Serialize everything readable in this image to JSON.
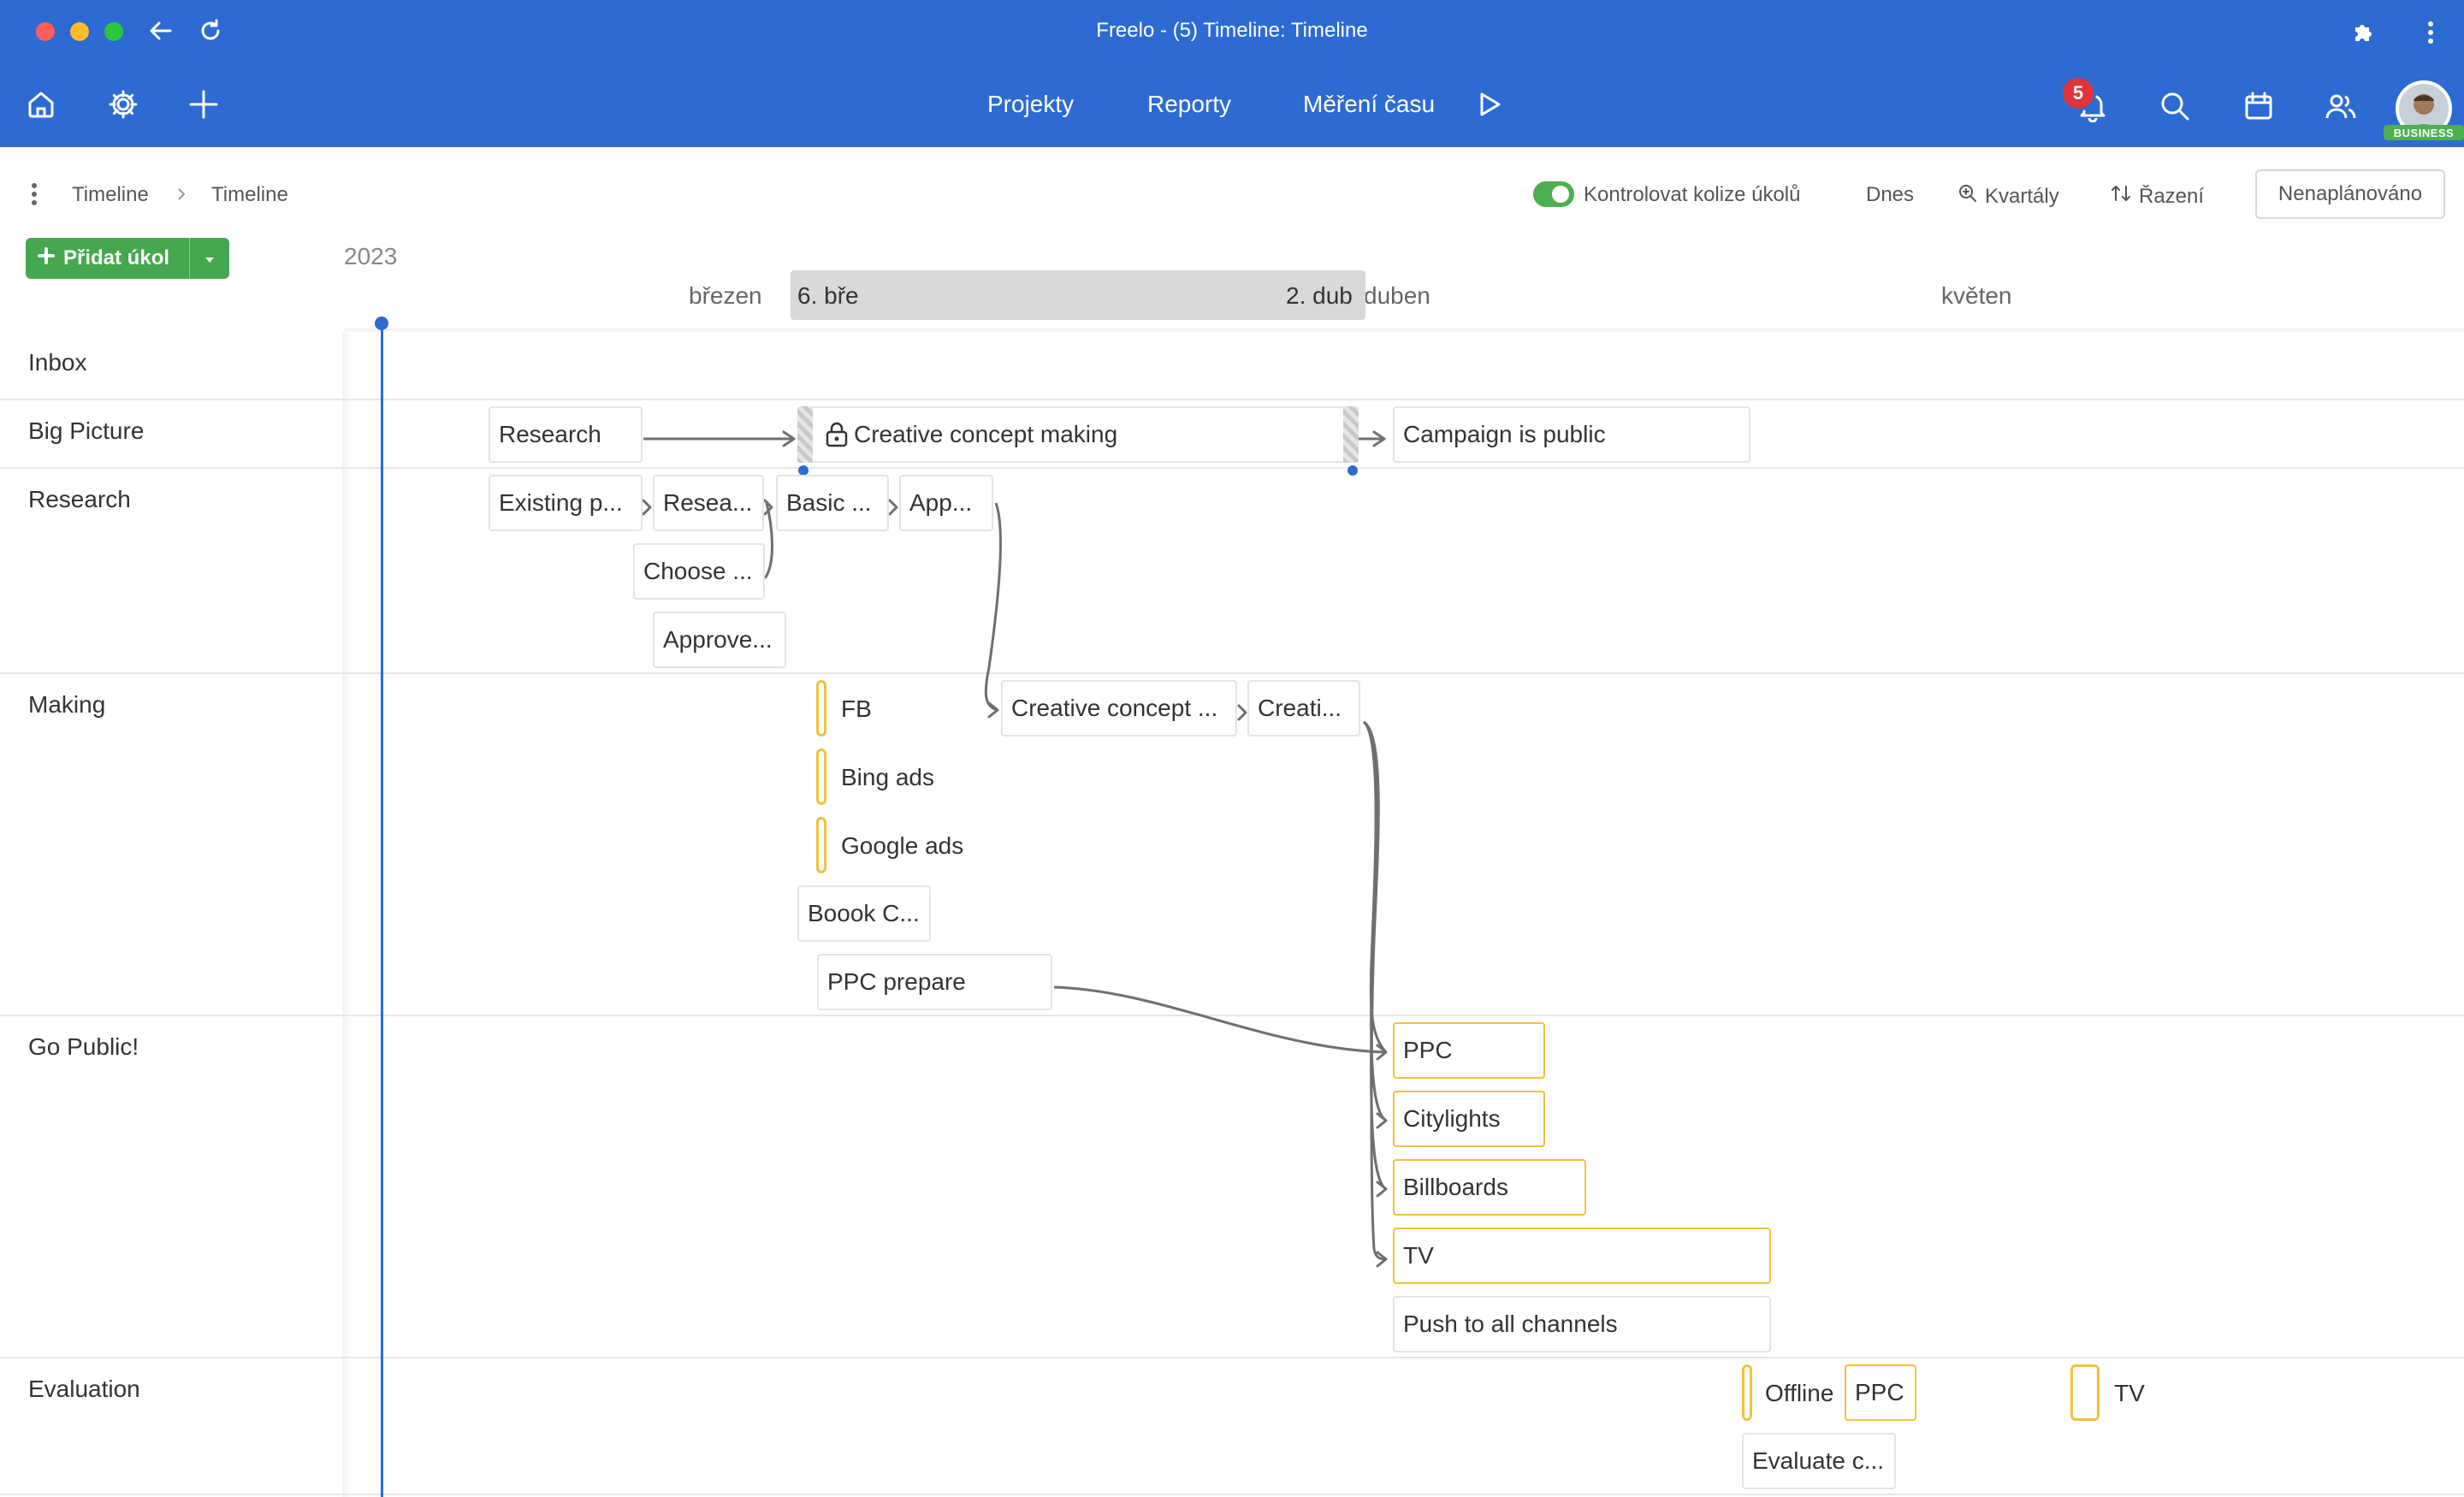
{
  "window": {
    "title": "Freelo - (5) Timeline: Timeline"
  },
  "nav": {
    "projects": "Projekty",
    "reports": "Reporty",
    "time": "Měření času"
  },
  "notifications": {
    "count": "5"
  },
  "user": {
    "plan_badge": "BUSINESS"
  },
  "breadcrumb": {
    "first": "Timeline",
    "second": "Timeline"
  },
  "toolbar": {
    "collision_label": "Kontrolovat kolize úkolů",
    "today": "Dnes",
    "quarters": "Kvartály",
    "sort": "Řazení",
    "unplanned": "Nenaplánováno"
  },
  "add_task": {
    "label": "Přidat úkol"
  },
  "timeline": {
    "year": "2023",
    "months": {
      "march": "březen",
      "april": "duben",
      "may": "květen"
    },
    "range": {
      "start": "6. bře",
      "end": "2. dub"
    }
  },
  "groups": {
    "inbox": "Inbox",
    "big_picture": "Big Picture",
    "research": "Research",
    "making": "Making",
    "go_public": "Go Public!",
    "evaluation": "Evaluation"
  },
  "tasks": {
    "research": "Research",
    "creative_concept_making": "Creative concept making",
    "campaign_public": "Campaign is public",
    "existing": "Existing p...",
    "resea": "Resea...",
    "basic": "Basic ...",
    "app": "App...",
    "choose": "Choose ...",
    "approve": "Approve...",
    "fb": "FB",
    "bing": "Bing ads",
    "google": "Google ads",
    "boook": "Boook C...",
    "ppc_prepare": "PPC prepare",
    "creative_concept": "Creative concept ...",
    "creati": "Creati...",
    "ppc": "PPC",
    "citylights": "Citylights",
    "billboards": "Billboards",
    "tv": "TV",
    "push": "Push to all channels",
    "offline": "Offline",
    "ppc_eval": "PPC",
    "tv_eval": "TV",
    "evaluate": "Evaluate c..."
  },
  "colors": {
    "brand": "#2d6bd3",
    "green": "#46a84e",
    "milestone": "#f2c23a",
    "notification": "#e0343b"
  }
}
